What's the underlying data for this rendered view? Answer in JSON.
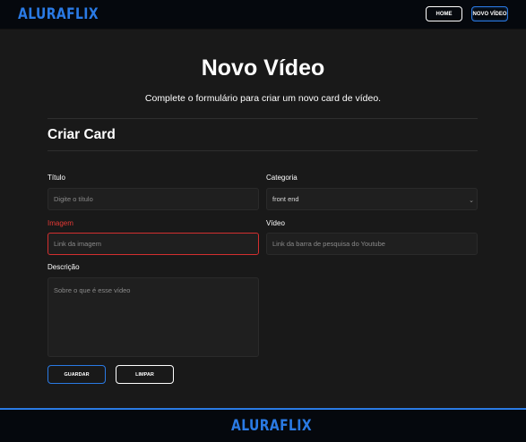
{
  "header": {
    "logo": "ALURAFLIX",
    "nav": {
      "home": "HOME",
      "novo_video": "NOVO VÍDEO"
    }
  },
  "main": {
    "title": "Novo Vídeo",
    "subtitle": "Complete o formulário para criar um novo card de vídeo.",
    "section_title": "Criar Card"
  },
  "form": {
    "titulo": {
      "label": "Título",
      "value": "",
      "placeholder": "Digite o título"
    },
    "categoria": {
      "label": "Categoria",
      "selected": "front end"
    },
    "imagem": {
      "label": "Imagem",
      "value": "",
      "placeholder": "Link da imagem"
    },
    "video": {
      "label": "Vídeo",
      "value": "",
      "placeholder": "Link da barra de pesquisa do Youtube"
    },
    "descricao": {
      "label": "Descrição",
      "value": "",
      "placeholder": "Sobre o que é esse vídeo"
    },
    "buttons": {
      "save": "GUARDAR",
      "clear": "LIMPAR"
    }
  },
  "footer": {
    "logo": "ALURAFLIX"
  },
  "colors": {
    "accent": "#2a7ae4",
    "error": "#d32f2f",
    "background": "#191919",
    "header_bg": "#05080d"
  }
}
